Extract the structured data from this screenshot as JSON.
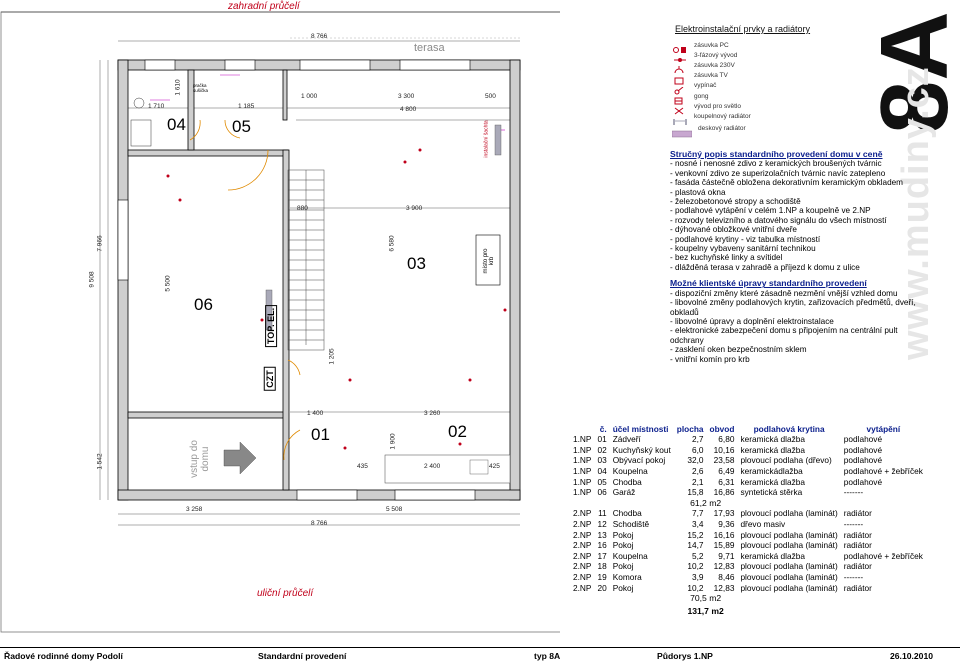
{
  "plan": {
    "garden_label": "zahradní průčelí",
    "street_label": "uliční průčelí",
    "terrace_label": "terasa",
    "entrance_label": "vstup do domu",
    "fireplace_label": "místo pro krb",
    "shaft_label": "instalační šachta",
    "wc_label": "pračka sušička",
    "czt_label": "CZT",
    "top_el_label": "TOP. EL.",
    "room_numbers": [
      "01",
      "02",
      "03",
      "04",
      "05",
      "06"
    ],
    "dimensions": {
      "top_total": "8 766",
      "bottom_total": "8 766",
      "left_total": "9 508",
      "left_inner": "7 966",
      "left_bottom": "1 542",
      "left_06": "5 500",
      "w04": "1 710",
      "w05": "1 185",
      "w_1000": "1 000",
      "w_3300": "3 300",
      "w_500": "500",
      "w_4800": "4 800",
      "w_880": "880",
      "w_3900": "3 900",
      "h_6580": "6 580",
      "h_1205": "1 205",
      "w_1400": "1 400",
      "w_3260": "3 260",
      "h_1900": "1 900",
      "w_435": "435",
      "w_2400": "2 400",
      "w_425": "425",
      "b_3258": "3 258",
      "b_5508": "5 508",
      "h_1610": "1 610"
    }
  },
  "legend": {
    "title": "Elektroinstalační prvky a radiátory",
    "items": [
      {
        "label": "zásuvka PC",
        "icon": "pc-socket-icon"
      },
      {
        "label": "3-fázový vývod",
        "icon": "three-phase-icon"
      },
      {
        "label": "zásuvka 230V",
        "icon": "socket-icon"
      },
      {
        "label": "zásuvka TV",
        "icon": "tv-socket-icon"
      },
      {
        "label": "vypínač",
        "icon": "switch-icon"
      },
      {
        "label": "gong",
        "icon": "gong-icon"
      },
      {
        "label": "vývod pro světlo",
        "icon": "light-outlet-icon"
      },
      {
        "label": "koupelnový radiátor",
        "icon": "bathroom-radiator-icon"
      },
      {
        "label": "deskový radiátor",
        "icon": "panel-radiator-icon"
      }
    ],
    "type_mark": "8A"
  },
  "description": {
    "standard_title": "Stručný popis standardního provedení domu v ceně",
    "standard_items": [
      "- nosné i nenosné zdivo z keramických broušených tvárnic",
      "- venkovní zdivo ze superizolačních tvárnic navíc zatepleno",
      "- fasáda částečně obložena dekorativním keramickým obkladem",
      "- plastová okna",
      "- železobetonové stropy a schodiště",
      "- podlahové vytápění v celém 1.NP a koupelně ve 2.NP",
      "- rozvody televizního a datového signálu do všech místností",
      "- dýhované obložkové vnitřní dveře",
      "- podlahové krytiny - viz tabulka místností",
      "- koupelny vybaveny sanitární technikou",
      "- bez kuchyňské linky a svítidel",
      "- dlážděná terasa v zahradě a příjezd k domu z ulice"
    ],
    "options_title": "Možné klientské úpravy standardního provedení",
    "options_items": [
      "- dispoziční změny které zásadně nezmění vnější vzhled domu",
      "- libovolné změny podlahových krytin, zařizovacích předmětů, dveří, obkladů",
      "- libovolné úpravy a doplnění elektroinstalace",
      "- elektronické zabezpečení domu s připojením na centrální pult odchrany",
      "- zasklení oken bezpečnostním sklem",
      "- vnitřní komín pro krb"
    ],
    "watermark": "www.mudiny.cz"
  },
  "table": {
    "headers": [
      "č.",
      "účel místnosti",
      "plocha",
      "obvod",
      "podlahová krytina",
      "vytápění"
    ],
    "rows_1np": [
      [
        "1.NP",
        "01",
        "Zádveří",
        "2,7",
        "6,80",
        "keramická dlažba",
        "podlahové"
      ],
      [
        "1.NP",
        "02",
        "Kuchyňský kout",
        "6,0",
        "10,16",
        "keramická dlažba",
        "podlahové"
      ],
      [
        "1.NP",
        "03",
        "Obývací pokoj",
        "32,0",
        "23,58",
        "plovoucí podlaha (dřevo)",
        "podlahové"
      ],
      [
        "1.NP",
        "04",
        "Koupelna",
        "2,6",
        "6,49",
        "keramickádlažba",
        "podlahové + žebříček"
      ],
      [
        "1.NP",
        "05",
        "Chodba",
        "2,1",
        "6,31",
        "keramická dlažba",
        "podlahové"
      ],
      [
        "1.NP",
        "06",
        "Garáž",
        "15,8",
        "16,86",
        "syntetická stěrka",
        "-------"
      ]
    ],
    "sum_1np": "61,2 m2",
    "rows_2np": [
      [
        "2.NP",
        "11",
        "Chodba",
        "7,7",
        "17,93",
        "plovoucí podlaha (laminát)",
        "radiátor"
      ],
      [
        "2.NP",
        "12",
        "Schodiště",
        "3,4",
        "9,36",
        "dřevo masiv",
        "-------"
      ],
      [
        "2.NP",
        "13",
        "Pokoj",
        "15,2",
        "16,16",
        "plovoucí podlaha (laminát)",
        "radiátor"
      ],
      [
        "2.NP",
        "16",
        "Pokoj",
        "14,7",
        "15,89",
        "plovoucí podlaha (laminát)",
        "radiátor"
      ],
      [
        "2.NP",
        "17",
        "Koupelna",
        "5,2",
        "9,71",
        "keramická dlažba",
        "podlahové + žebříček"
      ],
      [
        "2.NP",
        "18",
        "Pokoj",
        "10,2",
        "12,83",
        "plovoucí podlaha (laminát)",
        "radiátor"
      ],
      [
        "2.NP",
        "19",
        "Komora",
        "3,9",
        "8,46",
        "plovoucí podlaha (laminát)",
        "-------"
      ],
      [
        "2.NP",
        "20",
        "Pokoj",
        "10,2",
        "12,83",
        "plovoucí podlaha (laminát)",
        "radiátor"
      ]
    ],
    "sum_2np": "70,5 m2",
    "sum_total": "131,7 m2"
  },
  "footer": {
    "project": "Řadové rodinné domy Podolí",
    "variant": "Standardní provedení",
    "type": "typ 8A",
    "sheet": "Půdorys 1.NP",
    "date": "26.10.2010"
  },
  "colors": {
    "accent_blue": "#0a1e8c",
    "red_symbols": "#c0001a",
    "wall_fill": "#cfcfcf",
    "magenta_lines": "#c000c0",
    "radiator_gray": "#a9a9b8"
  }
}
